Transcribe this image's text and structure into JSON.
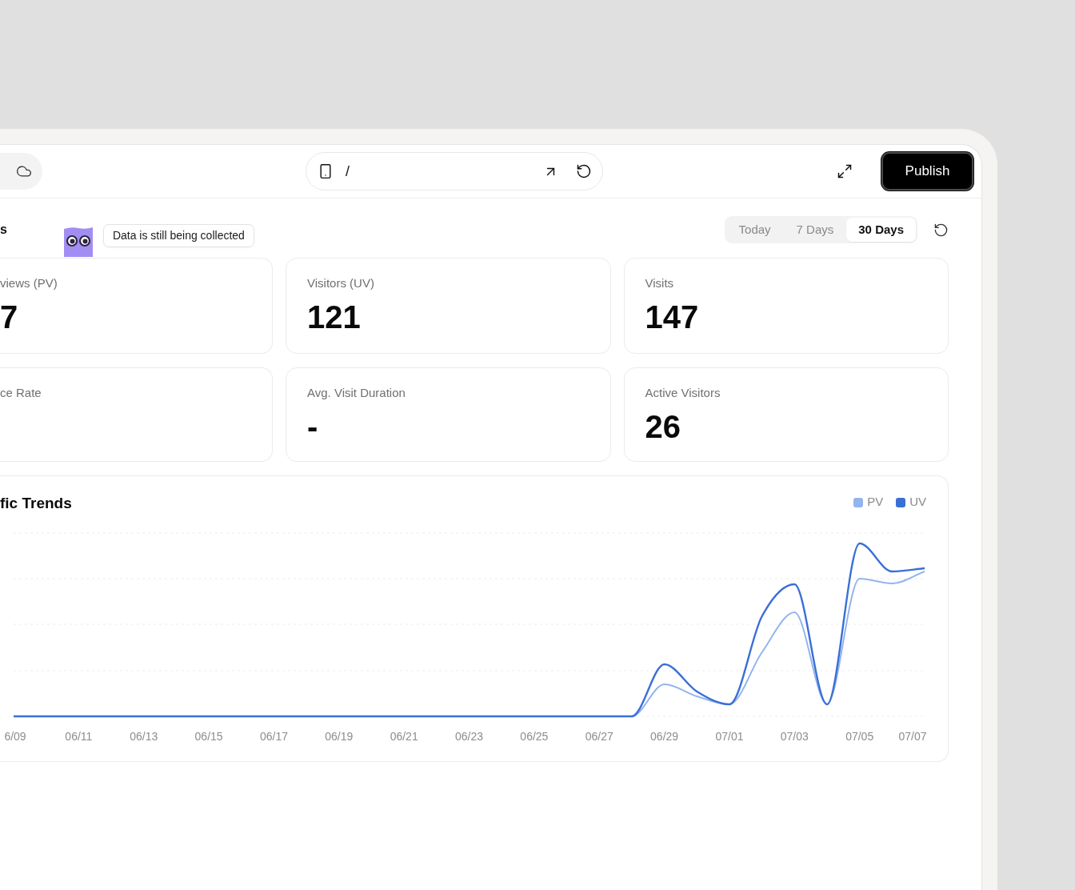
{
  "toolbar": {
    "url_path": "/",
    "publish_button": "Publish"
  },
  "header": {
    "title": "s",
    "status_badge": "Data is still being collected",
    "ranges": [
      {
        "label": "Today",
        "selected": false
      },
      {
        "label": "7 Days",
        "selected": false
      },
      {
        "label": "30 Days",
        "selected": true
      }
    ]
  },
  "stats": [
    {
      "label": "views (PV)",
      "value": "7"
    },
    {
      "label": "Visitors (UV)",
      "value": "121"
    },
    {
      "label": "Visits",
      "value": "147"
    },
    {
      "label": "ce Rate"
    },
    {
      "label": "Avg. Visit Duration",
      "value": "-"
    },
    {
      "label": "Active Visitors",
      "value": "26"
    }
  ],
  "traffic_chart": {
    "title": "fic Trends",
    "legend": [
      {
        "label": "PV",
        "color": "#94b4ee"
      },
      {
        "label": "UV",
        "color": "#3a6fd6"
      }
    ],
    "x_labels": [
      "6/09",
      "06/11",
      "06/13",
      "06/15",
      "06/17",
      "06/19",
      "06/21",
      "06/23",
      "06/25",
      "06/27",
      "06/29",
      "07/01",
      "07/03",
      "07/05",
      "07/07"
    ]
  }
}
